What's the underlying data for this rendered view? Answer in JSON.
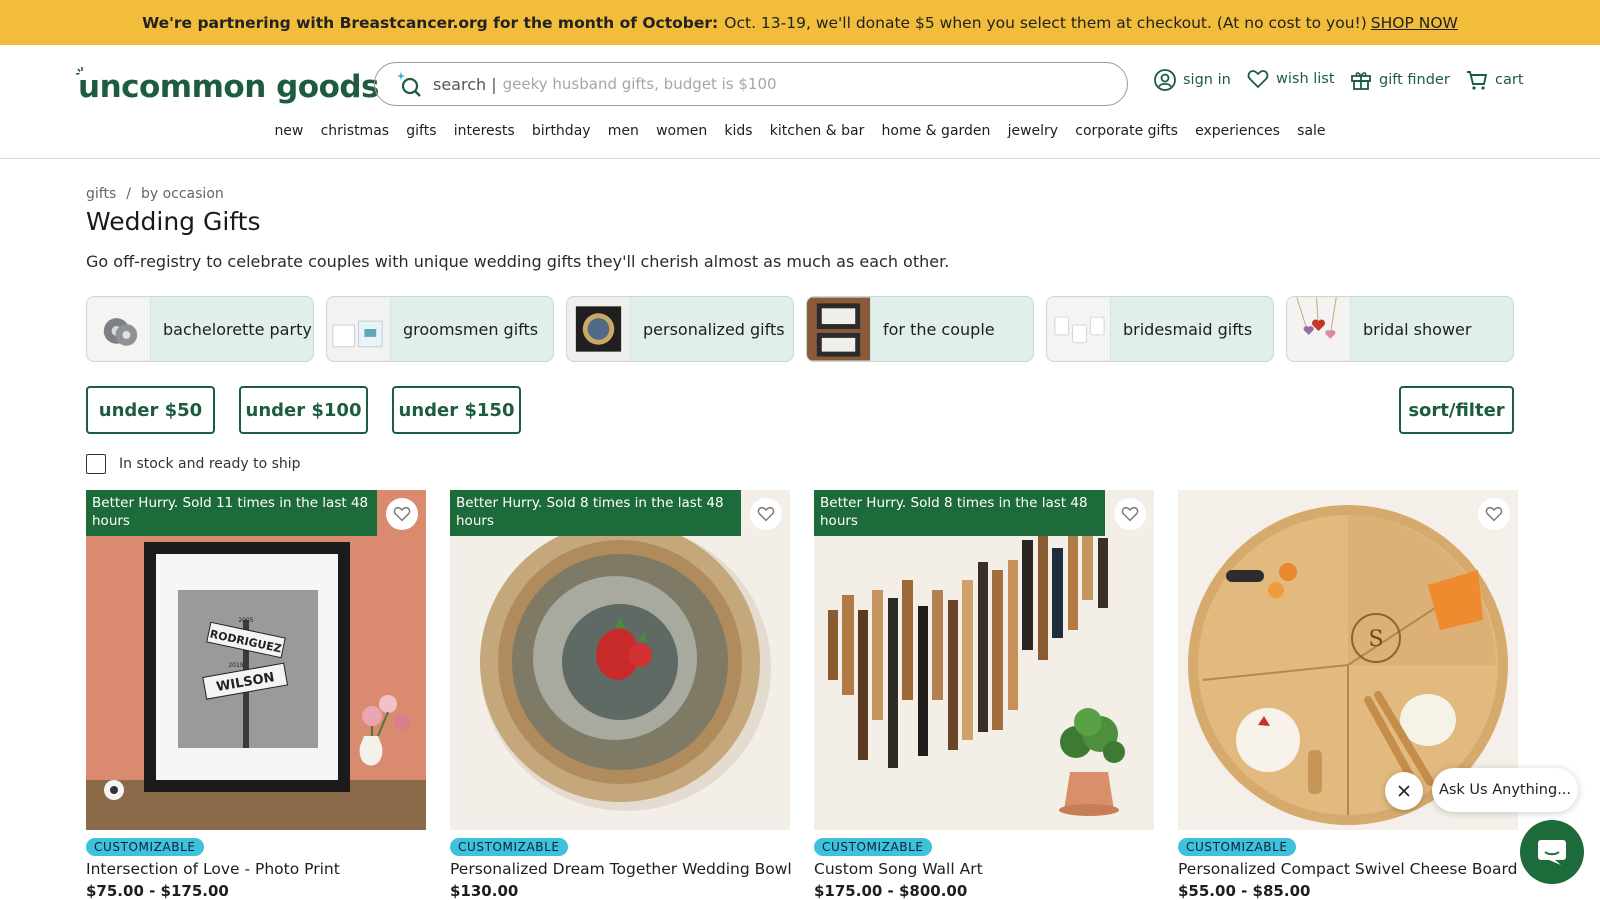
{
  "promo": {
    "bold": "We're partnering with Breastcancer.org for the month of October:",
    "text": "Oct. 13-19, we'll donate $5 when you select them at checkout. (At no cost to you!)",
    "link": "SHOP NOW"
  },
  "header": {
    "logo": "uncommon goods",
    "search_label": "search |",
    "search_placeholder": "geeky husband gifts, budget is $100",
    "sign_in": "sign in",
    "wish_list": "wish list",
    "gift_finder": "gift finder",
    "cart": "cart"
  },
  "nav": [
    "new",
    "christmas",
    "gifts",
    "interests",
    "birthday",
    "men",
    "women",
    "kids",
    "kitchen & bar",
    "home & garden",
    "jewelry",
    "corporate gifts",
    "experiences",
    "sale"
  ],
  "breadcrumb": {
    "root": "gifts",
    "sep": "/",
    "current": "by occasion"
  },
  "page": {
    "title": "Wedding Gifts",
    "description": "Go off-registry to celebrate couples with unique wedding gifts they'll cherish almost as much as each other."
  },
  "categories": [
    "bachelorette party",
    "groomsmen gifts",
    "personalized gifts",
    "for the couple",
    "bridesmaid gifts",
    "bridal shower"
  ],
  "price_filters": [
    "under $50",
    "under $100",
    "under $150"
  ],
  "sort_filter": "sort/filter",
  "stock_filter": "In stock and ready to ship",
  "products": [
    {
      "hurry": "Better Hurry. Sold 11 times in the last 48 hours",
      "badge": "CUSTOMIZABLE",
      "name": "Intersection of Love - Photo Print",
      "price": "$75.00 - $175.00",
      "sign1": "RODRIGUEZ",
      "sign2": "WILSON",
      "year1": "2005",
      "year2": "2019"
    },
    {
      "hurry": "Better Hurry. Sold 8 times in the last 48 hours",
      "badge": "CUSTOMIZABLE",
      "name": "Personalized Dream Together Wedding Bowl",
      "price": "$130.00"
    },
    {
      "hurry": "Better Hurry. Sold 8 times in the last 48 hours",
      "badge": "CUSTOMIZABLE",
      "name": "Custom Song Wall Art",
      "price": "$175.00 - $800.00"
    },
    {
      "badge": "CUSTOMIZABLE",
      "name": "Personalized Compact Swivel Cheese Board",
      "price": "$55.00 - $85.00",
      "monogram": "S"
    }
  ],
  "chat": {
    "prompt": "Ask Us Anything..."
  },
  "colors": {
    "brand_green": "#1d5c3f",
    "banner_yellow": "#f3bd3c",
    "chip_bg": "#e0efeb",
    "badge_cyan": "#3ec2dc"
  }
}
